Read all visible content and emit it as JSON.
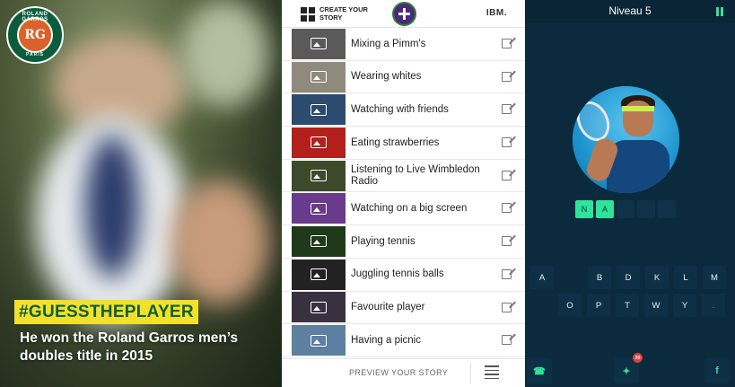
{
  "roland_garros": {
    "logo": {
      "top_text": "ROLAND GARROS",
      "monogram": "RG",
      "bottom_text": "PARIS"
    },
    "hashtag": "#GUESSTHEPLAYER",
    "caption": "He won the Roland Garros men’s doubles title in 2015",
    "colors": {
      "hashtag_bg": "#f2e02a",
      "hashtag_text": "#0e5f3a",
      "logo_green": "#0b5c3b",
      "logo_clay": "#d9622b"
    }
  },
  "wimbledon": {
    "header": {
      "create_label": "CREATE YOUR STORY",
      "sponsor": "IBM."
    },
    "stories": [
      {
        "label": "Mixing a Pimm's",
        "thumb_color": "#5a5a5a",
        "icon": "image-icon"
      },
      {
        "label": "Wearing whites",
        "thumb_color": "#8f8a7c",
        "icon": "image-icon"
      },
      {
        "label": "Watching with friends",
        "thumb_color": "#2c4b6e",
        "icon": "image-icon"
      },
      {
        "label": "Eating strawberries",
        "thumb_color": "#b3201c",
        "icon": "image-icon"
      },
      {
        "label": "Listening to Live Wimbledon Radio",
        "thumb_color": "#3c4a2a",
        "icon": "image-icon"
      },
      {
        "label": "Watching on a big screen",
        "thumb_color": "#6a3b8c",
        "icon": "image-icon"
      },
      {
        "label": "Playing tennis",
        "thumb_color": "#1f3a18",
        "icon": "image-icon"
      },
      {
        "label": "Juggling tennis balls",
        "thumb_color": "#222222",
        "icon": "image-icon"
      },
      {
        "label": "Favourite player",
        "thumb_color": "#3a3140",
        "icon": "image-icon"
      },
      {
        "label": "Having a picnic",
        "thumb_color": "#5d7fa0",
        "icon": "image-icon"
      }
    ],
    "footer": {
      "preview_label": "PREVIEW YOUR STORY"
    }
  },
  "quiz": {
    "title": "Niveau 5",
    "answer_slots": [
      "N",
      "A",
      "",
      "",
      ""
    ],
    "keyboard": {
      "row1": [
        "A",
        "",
        "B",
        "D",
        "K",
        "L",
        "M"
      ],
      "row2": [
        "O",
        "P",
        "T",
        "W",
        "Y",
        "."
      ]
    },
    "bottom": {
      "hint_count": "20",
      "left_icon": "phone-icon",
      "center_icon": "lightbulb-icon",
      "right_icon": "facebook-icon",
      "right_label": "f"
    },
    "colors": {
      "background": "#0c2a3e",
      "accent": "#2ee49a",
      "key": "#0e3046"
    }
  }
}
